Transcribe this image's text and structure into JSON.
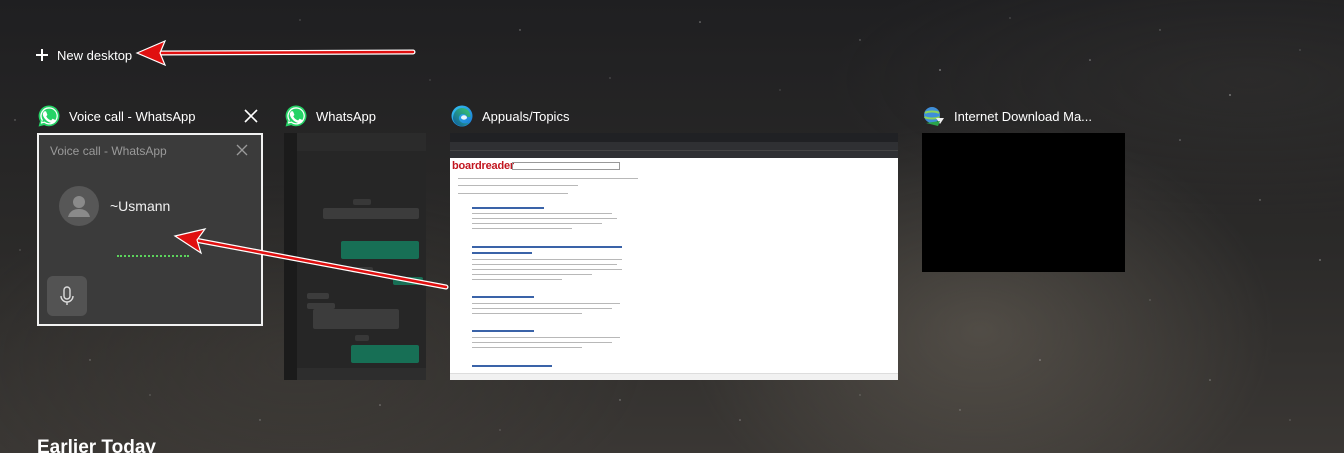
{
  "new_desktop": {
    "label": "New desktop",
    "icon": "plus-icon"
  },
  "windows": [
    {
      "title": "Voice call - WhatsApp",
      "icon": "whatsapp-icon",
      "preview": {
        "title": "Voice call - WhatsApp",
        "contact": "~Usmann",
        "icon": "microphone-icon"
      }
    },
    {
      "title": "WhatsApp",
      "icon": "whatsapp-icon"
    },
    {
      "title": "Appuals/Topics",
      "icon": "edge-browser-icon",
      "preview": {
        "site_logo": "boardreader"
      }
    },
    {
      "title": "Internet Download Ma...",
      "icon": "internet-download-manager-icon"
    }
  ],
  "section_heading": "Earlier Today",
  "colors": {
    "annotation_arrow": "#e01010",
    "whatsapp_green": "#25d366",
    "selection_border": "#f2f2f2"
  }
}
